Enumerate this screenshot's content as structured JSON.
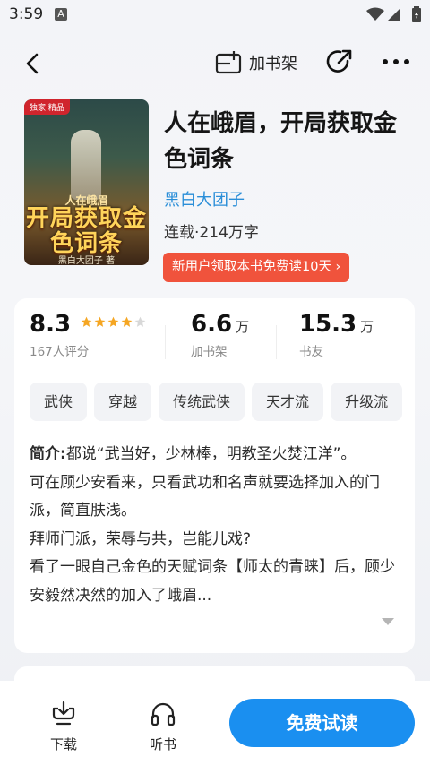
{
  "status": {
    "time": "3:59",
    "notif_icon": "A"
  },
  "nav": {
    "add_shelf_label": "加书架"
  },
  "book": {
    "cover": {
      "badge": "独家·精品",
      "title_small": "人在峨眉",
      "title_big": "开局获取金色词条",
      "author": "黑白大团子 著"
    },
    "title": "人在峨眉，开局获取金色词条",
    "author": "黑白大团子",
    "meta": "连载·214万字",
    "promo": "新用户领取本书免费读10天 ›"
  },
  "stats": {
    "rating": "8.3",
    "rating_label": "167人评分",
    "stars_filled": 4,
    "shelf_count": "6.6",
    "shelf_unit": "万",
    "shelf_label": "加书架",
    "friends_count": "15.3",
    "friends_unit": "万",
    "friends_label": "书友"
  },
  "tags": [
    "武侠",
    "穿越",
    "传统武侠",
    "天才流",
    "升级流"
  ],
  "intro": {
    "prefix": "简介:",
    "lines": [
      "都说“武当好，少林棒，明教圣火焚江洋”。",
      "可在顾少安看来，只看武功和名声就要选择加入的门派，简直肤浅。",
      "拜师门派，荣辱与共，岂能儿戏?",
      "看了一眼自己金色的天赋词条【师太的青睐】后，顾少安毅然决然的加入了峨眉..."
    ]
  },
  "bottom": {
    "download": "下载",
    "listen": "听书",
    "read": "免费试读"
  },
  "colors": {
    "accent": "#1a8ff0",
    "promo": "#f0533c",
    "author": "#2a8ed8",
    "star": "#f5a623"
  }
}
